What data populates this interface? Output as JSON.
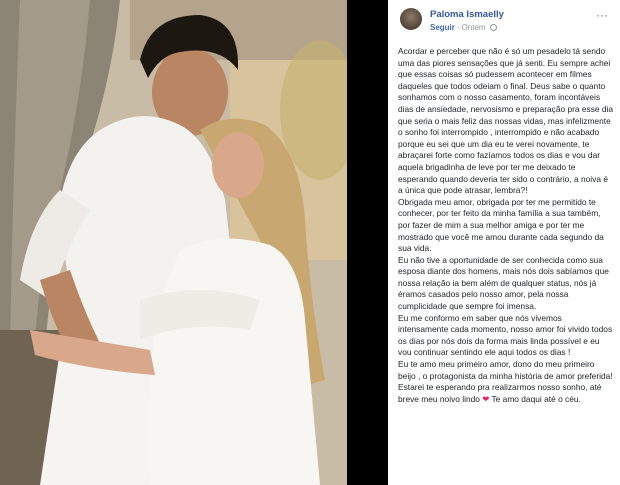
{
  "post": {
    "author": "Paloma Ismaelly",
    "follow_label": "Seguir",
    "separator": "·",
    "timestamp": "Ontem",
    "more_label": "···",
    "paragraphs": [
      "Acordar e perceber que não é só um pesadelo tá sendo uma das piores sensações que já senti. Eu sempre achei que essas coisas só pudessem acontecer em filmes daqueles que todos odeiam o final. Deus sabe o quanto sonhamos com o nosso casamento, foram incontáveis dias de ansiedade, nervosismo e preparação pra esse dia que seria o mais feliz das nossas vidas, mas infelizmente o sonho foi interrompido , interrompido e não acabado porque eu sei que um dia eu te verei novamente, te abraçarei forte como fazíamos todos os dias e vou dar aquela brigadinha de leve por ter me deixado te esperando quando deveria ter sido o contrário, a noiva é a única que pode atrasar, lembra?!",
      "Obrigada meu amor, obrigada por ter me permitido te conhecer, por ter feito da minha família a sua também, por fazer de mim a sua melhor amiga e por ter me mostrado que você me amou durante cada segundo da sua vida.",
      "Eu não tive a oportunidade de ser conhecida como sua esposa diante dos homens, mais nós dois sabíamos que nossa relação ia bem além de qualquer status, nós já éramos casados pelo nosso amor, pela nossa cumplicidade que sempre foi imensa.",
      "Eu me conformo em saber que nós vivemos intensamente cada momento, nosso amor foi vivido todos os dias por nós dois da forma mais linda possível e eu vou continuar sentindo ele aqui todos os dias !",
      "Eu te amo meu primeiro amor, dono do meu primeiro beijo , o protagonista da minha história de amor preferida!"
    ],
    "last_paragraph_before": "Estarei te esperando pra realizarmos nosso sonho, até breve meu noivo lindo",
    "heart_glyph": "❤",
    "last_paragraph_after": " Te amo daqui até o céu."
  },
  "colors": {
    "author_link": "#365899",
    "meta_text": "#90949c",
    "heart": "#e0245e"
  }
}
